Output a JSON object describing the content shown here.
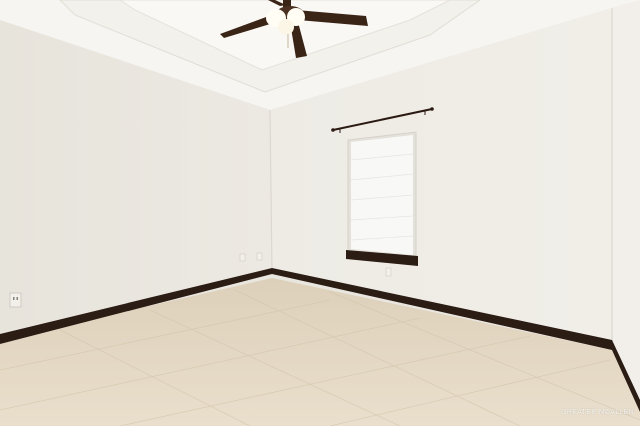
{
  "scene": {
    "watermark": "GREATER MCALLEN",
    "colors": {
      "left_wall": "#e9e6df",
      "back_wall": "#f0ede7",
      "right_wall": "#f2efea",
      "ceiling": "#f7f5f1",
      "baseboard": "#2b1c14",
      "floor": "#e6d9c3",
      "fan_blade": "#3a2416",
      "window_blind": "#f8f8f6"
    },
    "icons": [
      "ceiling-fan-icon",
      "curtain-rod-icon",
      "window-icon",
      "outlet-icon"
    ]
  }
}
